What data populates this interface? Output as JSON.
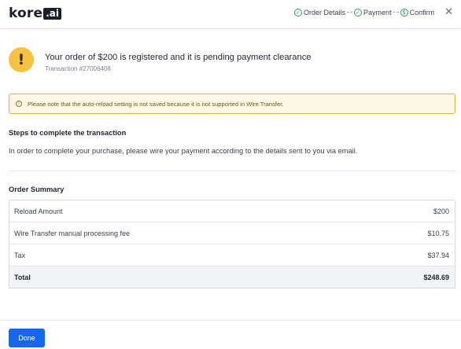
{
  "header": {
    "logo_text": "kore",
    "logo_box": ".ai",
    "steps": [
      {
        "label": "Order Details",
        "icon": "check-circle-icon",
        "glyph": "✓"
      },
      {
        "label": "Payment",
        "icon": "check-circle-icon",
        "glyph": "✓"
      },
      {
        "label": "Confirm",
        "icon": "dollar-circle-icon",
        "glyph": "$"
      }
    ],
    "close_glyph": "✕"
  },
  "status": {
    "icon_glyph": "!",
    "title": "Your order of $200 is registered and it is pending payment clearance",
    "transaction": "Transaction #27006408"
  },
  "note": {
    "icon_glyph": "i",
    "text": "Please note that the auto-reload setting is not saved because it is not supported in Wire Transfer."
  },
  "steps_section": {
    "title": "Steps to complete the transaction",
    "description": "In order to complete your purchase, please wire your payment according to the details sent to you via email."
  },
  "order_summary": {
    "title": "Order Summary",
    "rows": [
      {
        "label": "Reload Amount",
        "value": "$200"
      },
      {
        "label": "Wire Transfer manual processing fee",
        "value": "$10.75"
      },
      {
        "label": "Tax",
        "value": "$37.94"
      }
    ],
    "total": {
      "label": "Total",
      "value": "$248.69"
    }
  },
  "footer": {
    "done_label": "Done"
  },
  "colors": {
    "accent": "#1467f0",
    "success": "#2e9e4f",
    "warning": "#f5c242",
    "note_bg": "#fcf7e2",
    "note_border": "#d9b340"
  }
}
